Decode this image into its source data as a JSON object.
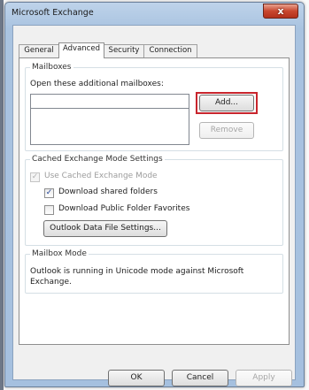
{
  "window": {
    "title": "Microsoft Exchange",
    "close_glyph": "x"
  },
  "tabs": [
    {
      "label": "General",
      "accel": "",
      "active": false
    },
    {
      "label": "Advanced",
      "accel": "",
      "active": true
    },
    {
      "label": "Security",
      "accel": "",
      "active": false
    },
    {
      "label": "Connection",
      "accel": "",
      "active": false
    }
  ],
  "mailboxes": {
    "group_label": "Mailboxes",
    "instruction": "Open these additional mailboxes:",
    "items": [],
    "add_label": "Add...",
    "remove_label": "Remove",
    "add_highlight_color": "#c8252d"
  },
  "cached": {
    "group_label": "Cached Exchange Mode Settings",
    "use_cached": {
      "label": "Use Cached Exchange Mode",
      "checked": true,
      "enabled": false
    },
    "download_shared": {
      "label": "Download shared folders",
      "checked": true,
      "enabled": true
    },
    "download_public": {
      "label": "Download Public Folder Favorites",
      "checked": false,
      "enabled": true
    },
    "ost_settings_label": "Outlook Data File Settings..."
  },
  "mailbox_mode": {
    "group_label": "Mailbox Mode",
    "text_line1": "Outlook is running in Unicode mode against Microsoft",
    "text_line2": "Exchange."
  },
  "dialog_buttons": {
    "ok": "OK",
    "cancel": "Cancel",
    "apply": "Apply"
  },
  "icons": {
    "check": "✓",
    "close": "x"
  }
}
